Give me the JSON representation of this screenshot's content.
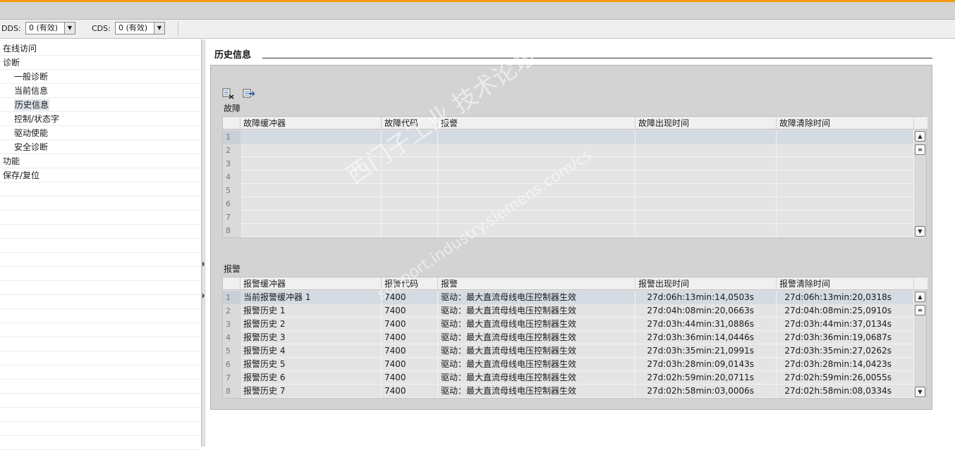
{
  "toolbar": {
    "dds_label": "DDS:",
    "dds_value": "0 (有效)",
    "cds_label": "CDS:",
    "cds_value": "0 (有效)"
  },
  "nav": {
    "items": [
      {
        "label": "在线访问",
        "level": 0
      },
      {
        "label": "诊断",
        "level": 0
      },
      {
        "label": "一般诊断",
        "level": 1
      },
      {
        "label": "当前信息",
        "level": 1
      },
      {
        "label": "历史信息",
        "level": 1,
        "selected": true
      },
      {
        "label": "控制/状态字",
        "level": 1
      },
      {
        "label": "驱动使能",
        "level": 1
      },
      {
        "label": "安全诊断",
        "level": 1
      },
      {
        "label": "功能",
        "level": 0
      },
      {
        "label": "保存/复位",
        "level": 0
      }
    ]
  },
  "page": {
    "title": "历史信息"
  },
  "fault": {
    "section_label": "故障",
    "headers": [
      "故障缓冲器",
      "故障代码",
      "报警",
      "故障出现时间",
      "故障清除时间"
    ],
    "row_numbers": [
      "1",
      "2",
      "3",
      "4",
      "5",
      "6",
      "7",
      "8"
    ]
  },
  "alarm": {
    "section_label": "报警",
    "headers": [
      "报警缓冲器",
      "报警代码",
      "报警",
      "报警出现时间",
      "报警清除时间"
    ],
    "rows": [
      {
        "n": "1",
        "buffer": "当前报警缓冲器 1",
        "code": "7400",
        "msg": "驱动：最大直流母线电压控制器生效",
        "start": "27d:06h:13min:14,0503s",
        "clear": "27d:06h:13min:20,0318s"
      },
      {
        "n": "2",
        "buffer": "报警历史 1",
        "code": "7400",
        "msg": "驱动：最大直流母线电压控制器生效",
        "start": "27d:04h:08min:20,0663s",
        "clear": "27d:04h:08min:25,0910s"
      },
      {
        "n": "3",
        "buffer": "报警历史 2",
        "code": "7400",
        "msg": "驱动：最大直流母线电压控制器生效",
        "start": "27d:03h:44min:31,0886s",
        "clear": "27d:03h:44min:37,0134s"
      },
      {
        "n": "4",
        "buffer": "报警历史 3",
        "code": "7400",
        "msg": "驱动：最大直流母线电压控制器生效",
        "start": "27d:03h:36min:14,0446s",
        "clear": "27d:03h:36min:19,0687s"
      },
      {
        "n": "5",
        "buffer": "报警历史 4",
        "code": "7400",
        "msg": "驱动：最大直流母线电压控制器生效",
        "start": "27d:03h:35min:21,0991s",
        "clear": "27d:03h:35min:27,0262s"
      },
      {
        "n": "6",
        "buffer": "报警历史 5",
        "code": "7400",
        "msg": "驱动：最大直流母线电压控制器生效",
        "start": "27d:03h:28min:09,0143s",
        "clear": "27d:03h:28min:14,0423s"
      },
      {
        "n": "7",
        "buffer": "报警历史 6",
        "code": "7400",
        "msg": "驱动：最大直流母线电压控制器生效",
        "start": "27d:02h:59min:20,0711s",
        "clear": "27d:02h:59min:26,0055s"
      },
      {
        "n": "8",
        "buffer": "报警历史 7",
        "code": "7400",
        "msg": "驱动：最大直流母线电压控制器生效",
        "start": "27d:02h:58min:03,0006s",
        "clear": "27d:02h:58min:08,0334s"
      }
    ]
  },
  "watermark": {
    "line1": "西门子工业  技术论坛",
    "line2": "support.industry.siemens.com/cs"
  },
  "icons": {
    "clear": "delete-log-icon",
    "export": "export-icon",
    "scroll_up": "scroll-up-arrow-icon",
    "scroll_down": "scroll-down-arrow-icon",
    "scroll_thumb": "scroll-thumb-icon"
  },
  "colors": {
    "accent": "#f39c12",
    "content_bg": "#d3d3d3",
    "selected_row": "#d4dbe3"
  }
}
